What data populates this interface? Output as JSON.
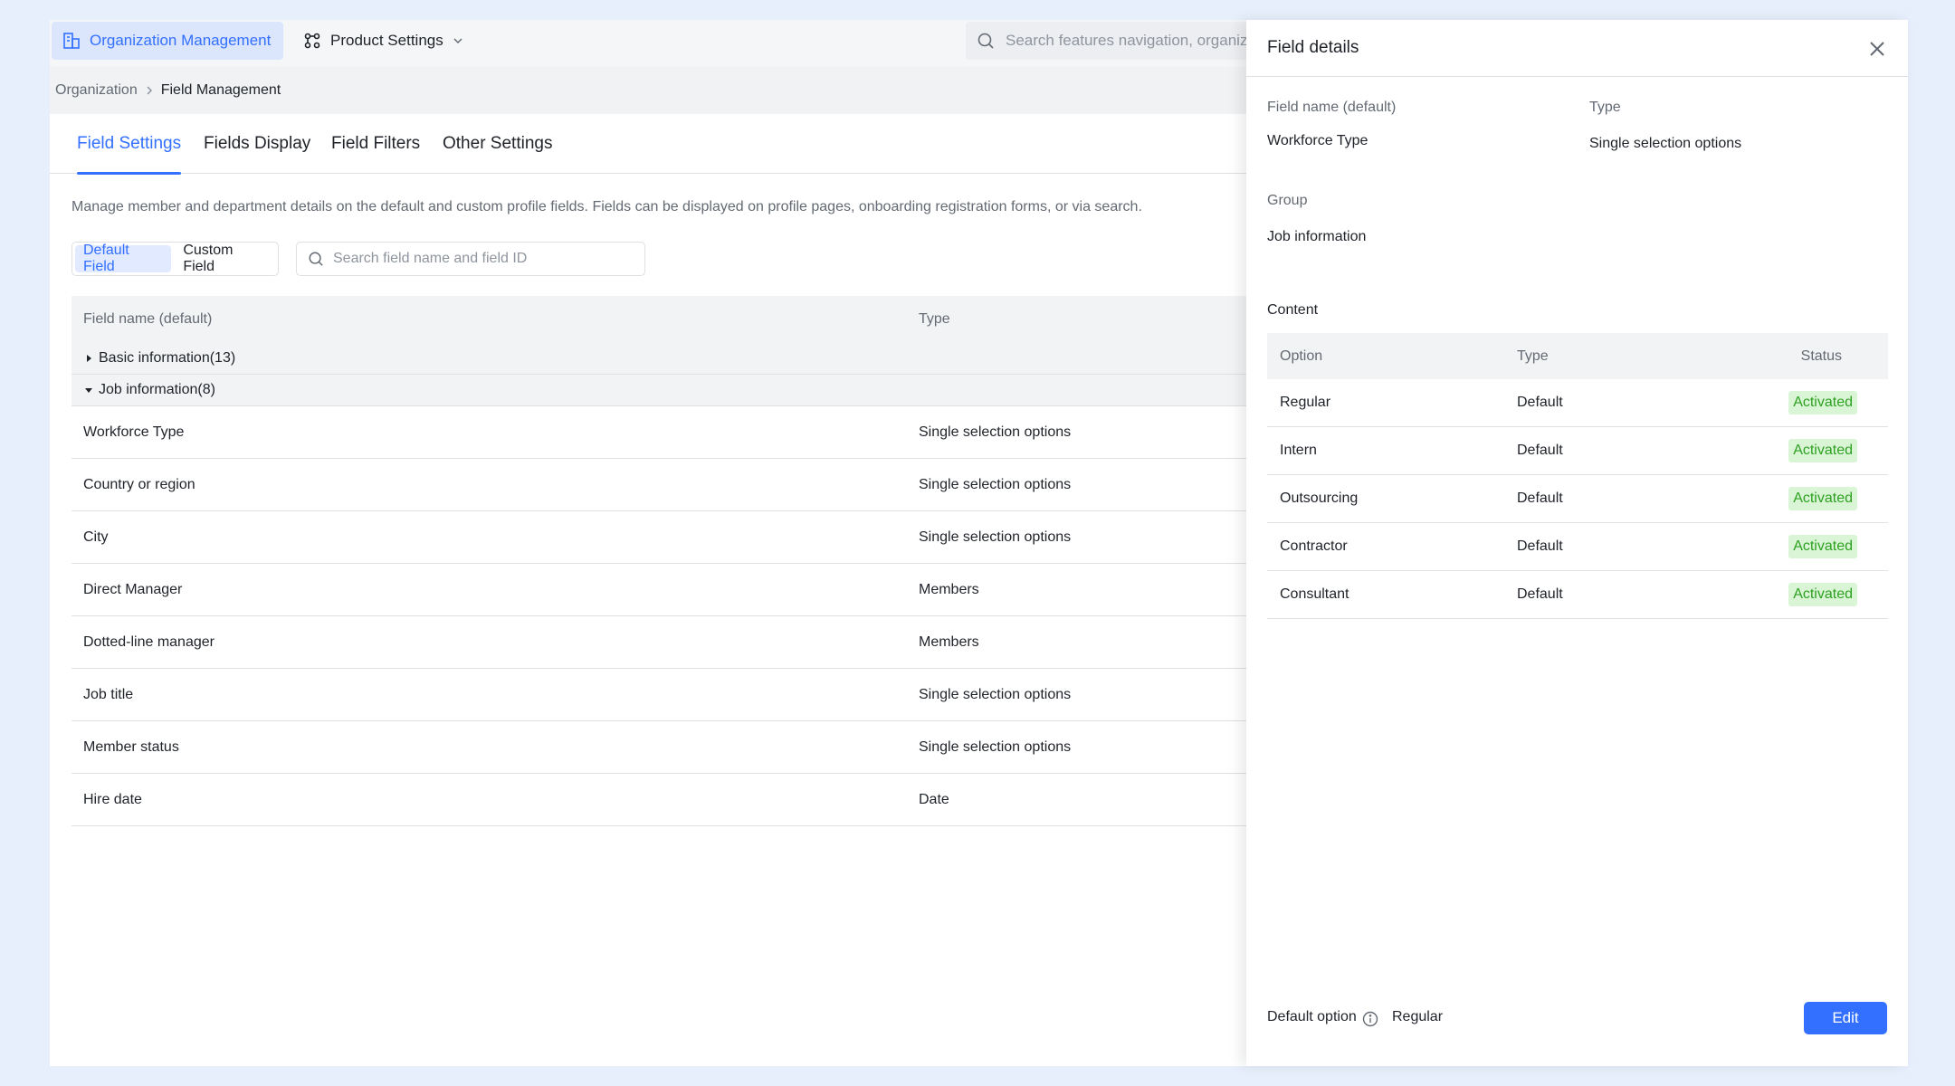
{
  "topnav": {
    "org_label": "Organization Management",
    "product_label": "Product Settings",
    "search_placeholder": "Search features navigation, organizati"
  },
  "breadcrumb": {
    "root": "Organization",
    "current": "Field Management"
  },
  "tabs": [
    {
      "label": "Field Settings",
      "active": true
    },
    {
      "label": "Fields Display",
      "active": false
    },
    {
      "label": "Field Filters",
      "active": false
    },
    {
      "label": "Other Settings",
      "active": false
    }
  ],
  "description": "Manage member and department details on the default and custom profile fields. Fields can be displayed on profile pages, onboarding registration forms, or via search.",
  "segment": {
    "default_label": "Default Field",
    "custom_label": "Custom Field"
  },
  "field_search_placeholder": "Search field name and field ID",
  "table": {
    "headers": {
      "name": "Field name (default)",
      "type": "Type"
    },
    "groups": [
      {
        "label": "Basic information(13)",
        "expanded": false
      },
      {
        "label": "Job information(8)",
        "expanded": true
      }
    ],
    "rows": [
      {
        "name": "Workforce Type",
        "type": "Single selection options"
      },
      {
        "name": "Country or region",
        "type": "Single selection options"
      },
      {
        "name": "City",
        "type": "Single selection options"
      },
      {
        "name": "Direct Manager",
        "type": "Members"
      },
      {
        "name": "Dotted-line manager",
        "type": "Members"
      },
      {
        "name": "Job title",
        "type": "Single selection options"
      },
      {
        "name": "Member status",
        "type": "Single selection options"
      },
      {
        "name": "Hire date",
        "type": "Date"
      }
    ]
  },
  "panel": {
    "title": "Field details",
    "field_name_label": "Field name (default)",
    "field_name_value": "Workforce Type",
    "type_label": "Type",
    "type_value": "Single selection options",
    "group_label": "Group",
    "group_value": "Job information",
    "content_label": "Content",
    "content_headers": {
      "option": "Option",
      "type": "Type",
      "status": "Status"
    },
    "options": [
      {
        "option": "Regular",
        "type": "Default",
        "status": "Activated"
      },
      {
        "option": "Intern",
        "type": "Default",
        "status": "Activated"
      },
      {
        "option": "Outsourcing",
        "type": "Default",
        "status": "Activated"
      },
      {
        "option": "Contractor",
        "type": "Default",
        "status": "Activated"
      },
      {
        "option": "Consultant",
        "type": "Default",
        "status": "Activated"
      }
    ],
    "default_option_label": "Default option",
    "default_option_value": "Regular",
    "edit_label": "Edit"
  },
  "colors": {
    "accent": "#3370ff",
    "badge_bg": "#d9f5d6",
    "badge_text": "#2ea121",
    "page_bg": "#e8effc"
  }
}
